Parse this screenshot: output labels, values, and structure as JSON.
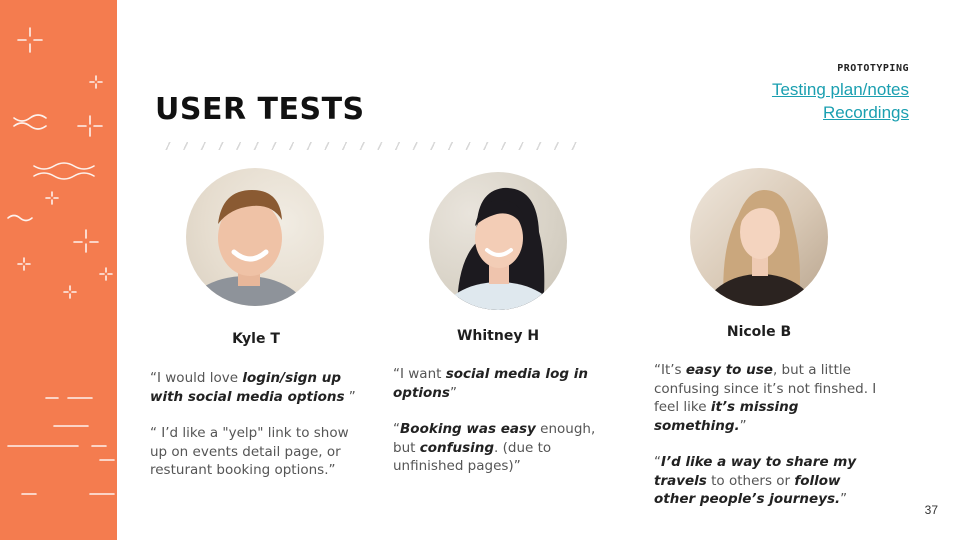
{
  "slide": {
    "eyebrow": "PROTOTYPING",
    "title": "USER TESTS",
    "page_number": "37",
    "accent_color": "#f47c4f",
    "link_color": "#1a9fb0"
  },
  "links": [
    {
      "label": "Testing plan/notes"
    },
    {
      "label": "Recordings"
    }
  ],
  "people": [
    {
      "name": "Kyle T",
      "quotes": [
        [
          {
            "t": "“I would love ",
            "b": false
          },
          {
            "t": "login/sign up with social media options",
            "b": true
          },
          {
            "t": " ”",
            "b": false
          }
        ],
        [
          {
            "t": "“ I’d like a \"yelp\" link to show up on events detail page, or resturant booking options.”",
            "b": false
          }
        ]
      ]
    },
    {
      "name": "Whitney H",
      "quotes": [
        [
          {
            "t": "“I want ",
            "b": false
          },
          {
            "t": "social media log in options",
            "b": true
          },
          {
            "t": "”",
            "b": false
          }
        ],
        [
          {
            "t": "“",
            "b": false
          },
          {
            "t": "Booking was easy",
            "b": true
          },
          {
            "t": " enough, but ",
            "b": false
          },
          {
            "t": "confusing",
            "b": true
          },
          {
            "t": ". (due to unfinished pages)”",
            "b": false
          }
        ]
      ]
    },
    {
      "name": "Nicole B",
      "quotes": [
        [
          {
            "t": "“It’s ",
            "b": false
          },
          {
            "t": "easy to use",
            "b": true
          },
          {
            "t": ", but a little confusing since it’s not finshed. I feel like ",
            "b": false
          },
          {
            "t": "it’s missing something.",
            "b": true
          },
          {
            "t": "”",
            "b": false
          }
        ],
        [
          {
            "t": "“",
            "b": false
          },
          {
            "t": "I’d like a way to share my travels",
            "b": true
          },
          {
            "t": " to others or ",
            "b": false
          },
          {
            "t": "follow other people’s journeys.",
            "b": true
          },
          {
            "t": "”",
            "b": false
          }
        ]
      ]
    }
  ]
}
